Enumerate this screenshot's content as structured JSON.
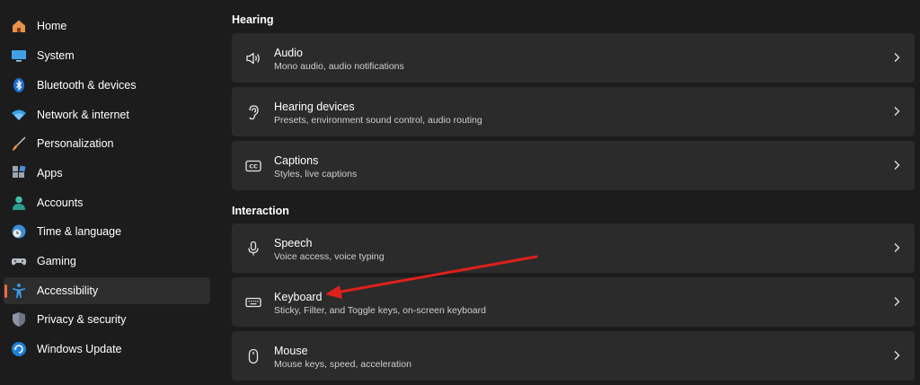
{
  "sidebar": {
    "items": [
      {
        "label": "Home",
        "icon": "home-icon",
        "active": false
      },
      {
        "label": "System",
        "icon": "monitor-icon",
        "active": false
      },
      {
        "label": "Bluetooth & devices",
        "icon": "bluetooth-icon",
        "active": false
      },
      {
        "label": "Network & internet",
        "icon": "wifi-icon",
        "active": false
      },
      {
        "label": "Personalization",
        "icon": "brush-icon",
        "active": false
      },
      {
        "label": "Apps",
        "icon": "apps-icon",
        "active": false
      },
      {
        "label": "Accounts",
        "icon": "person-icon",
        "active": false
      },
      {
        "label": "Time & language",
        "icon": "globe-clock-icon",
        "active": false
      },
      {
        "label": "Gaming",
        "icon": "gamepad-icon",
        "active": false
      },
      {
        "label": "Accessibility",
        "icon": "accessibility-icon",
        "active": true
      },
      {
        "label": "Privacy & security",
        "icon": "shield-icon",
        "active": false
      },
      {
        "label": "Windows Update",
        "icon": "update-icon",
        "active": false
      }
    ],
    "accent_color": "#f06a45"
  },
  "main": {
    "sections": [
      {
        "title": "Hearing",
        "cards": [
          {
            "title": "Audio",
            "subtitle": "Mono audio, audio notifications",
            "icon": "speaker-icon"
          },
          {
            "title": "Hearing devices",
            "subtitle": "Presets, environment sound control, audio routing",
            "icon": "ear-icon"
          },
          {
            "title": "Captions",
            "subtitle": "Styles, live captions",
            "icon": "captions-icon"
          }
        ]
      },
      {
        "title": "Interaction",
        "cards": [
          {
            "title": "Speech",
            "subtitle": "Voice access, voice typing",
            "icon": "microphone-icon"
          },
          {
            "title": "Keyboard",
            "subtitle": "Sticky, Filter, and Toggle keys, on-screen keyboard",
            "icon": "keyboard-icon"
          },
          {
            "title": "Mouse",
            "subtitle": "Mouse keys, speed, acceleration",
            "icon": "mouse-icon"
          }
        ]
      }
    ]
  },
  "annotation": {
    "type": "arrow",
    "target": "Keyboard",
    "color": "#e0201b"
  }
}
